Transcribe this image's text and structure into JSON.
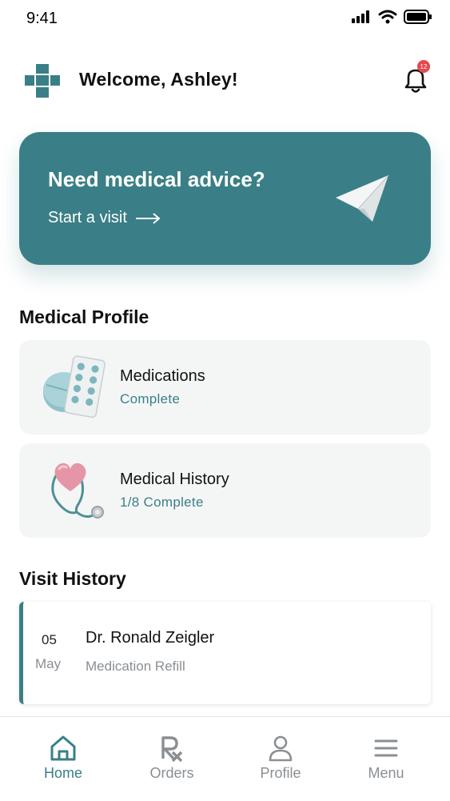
{
  "status": {
    "time": "9:41"
  },
  "header": {
    "welcome": "Welcome, Ashley!",
    "notification_count": "12"
  },
  "advice": {
    "title": "Need medical advice?",
    "link": "Start a visit"
  },
  "medical_profile": {
    "title": "Medical Profile",
    "items": [
      {
        "title": "Medications",
        "status": "Complete"
      },
      {
        "title": "Medical History",
        "status": "1/8 Complete"
      }
    ]
  },
  "visit_history": {
    "title": "Visit History",
    "visits": [
      {
        "day": "05",
        "month": "May",
        "doctor": "Dr. Ronald Zeigler",
        "reason": "Medication Refill"
      }
    ]
  },
  "tabs": [
    {
      "label": "Home",
      "icon": "home-icon",
      "active": true
    },
    {
      "label": "Orders",
      "icon": "rx-icon",
      "active": false
    },
    {
      "label": "Profile",
      "icon": "user-icon",
      "active": false
    },
    {
      "label": "Menu",
      "icon": "menu-icon",
      "active": false
    }
  ],
  "colors": {
    "accent": "#3a7f87",
    "badge": "#e5484d",
    "muted": "#8a8f94",
    "card_bg": "#f4f6f6"
  }
}
